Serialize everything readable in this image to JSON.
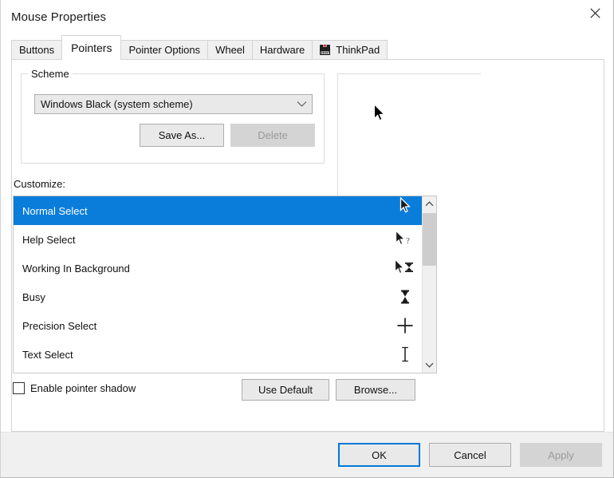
{
  "window": {
    "title": "Mouse Properties",
    "close_icon": "close-icon"
  },
  "tabs": [
    {
      "label": "Buttons",
      "active": false,
      "icon": null
    },
    {
      "label": "Pointers",
      "active": true,
      "icon": null
    },
    {
      "label": "Pointer Options",
      "active": false,
      "icon": null
    },
    {
      "label": "Wheel",
      "active": false,
      "icon": null
    },
    {
      "label": "Hardware",
      "active": false,
      "icon": null
    },
    {
      "label": "ThinkPad",
      "active": false,
      "icon": "thinkpad-icon"
    }
  ],
  "scheme": {
    "legend": "Scheme",
    "selected_value": "Windows Black (system scheme)",
    "dropdown_icon": "chevron-down-icon",
    "save_as_label": "Save As...",
    "delete_label": "Delete",
    "delete_disabled": true
  },
  "preview": {
    "cursor_icon": "arrow-cursor-icon"
  },
  "customize": {
    "label": "Customize:",
    "rows": [
      {
        "name": "Normal Select",
        "glyph": "arrow-cursor-icon",
        "selected": true
      },
      {
        "name": "Help Select",
        "glyph": "arrow-help-cursor-icon",
        "selected": false
      },
      {
        "name": "Working In Background",
        "glyph": "arrow-hourglass-cursor-icon",
        "selected": false
      },
      {
        "name": "Busy",
        "glyph": "hourglass-cursor-icon",
        "selected": false
      },
      {
        "name": "Precision Select",
        "glyph": "crosshair-cursor-icon",
        "selected": false
      },
      {
        "name": "Text Select",
        "glyph": "ibeam-cursor-icon",
        "selected": false
      }
    ],
    "scroll_up_icon": "chevron-up-icon",
    "scroll_down_icon": "chevron-down-icon"
  },
  "options": {
    "pointer_shadow_label": "Enable pointer shadow",
    "pointer_shadow_checked": false,
    "use_default_label": "Use Default",
    "browse_label": "Browse..."
  },
  "footer": {
    "ok_label": "OK",
    "cancel_label": "Cancel",
    "apply_label": "Apply",
    "apply_disabled": true
  },
  "colors": {
    "accent": "#0a7ddb",
    "focus_border": "#0078d7",
    "dialog_bg": "#ffffff",
    "footer_bg": "#f0f0f0",
    "button_bg": "#e9e9e9",
    "disabled_text": "#9a9a9a"
  }
}
